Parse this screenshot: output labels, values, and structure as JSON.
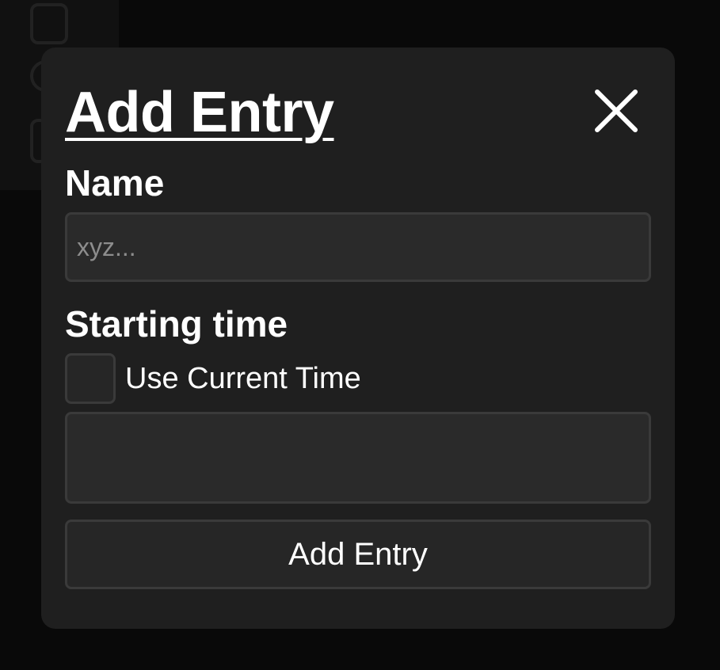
{
  "background": {
    "icons": [
      "chart-icon",
      "phone-icon",
      "document-icon"
    ]
  },
  "modal": {
    "title": "Add Entry",
    "close_icon": "close-icon",
    "name_label": "Name",
    "name_placeholder": "xyz...",
    "name_value": "",
    "starting_time_label": "Starting time",
    "use_current_time_label": "Use Current Time",
    "use_current_time_checked": false,
    "time_value": "",
    "submit_label": "Add Entry"
  },
  "colors": {
    "page_background": "#090909",
    "modal_background": "#1f1f1f",
    "input_background": "#2a2a2a",
    "border": "#3a3a3a",
    "text": "#ffffff",
    "placeholder": "#8d8d8d"
  }
}
